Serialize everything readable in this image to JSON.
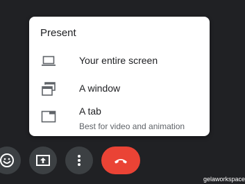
{
  "present_menu": {
    "title": "Present",
    "items": [
      {
        "id": "entire-screen",
        "label": "Your entire screen",
        "icon": "laptop-icon"
      },
      {
        "id": "window",
        "label": "A window",
        "icon": "window-stack-icon"
      },
      {
        "id": "tab",
        "label": "A tab",
        "sublabel": "Best for video and animation",
        "icon": "tab-icon"
      }
    ]
  },
  "controls": [
    {
      "id": "reactions",
      "icon": "smiley-icon"
    },
    {
      "id": "present",
      "icon": "present-screen-icon"
    },
    {
      "id": "more",
      "icon": "more-vert-icon"
    },
    {
      "id": "hangup",
      "icon": "phone-hangup-icon"
    }
  ],
  "colors": {
    "background": "#202124",
    "hangup": "#ea4335",
    "control_bg": "#3c4043"
  },
  "watermark": "gelaworkspace"
}
